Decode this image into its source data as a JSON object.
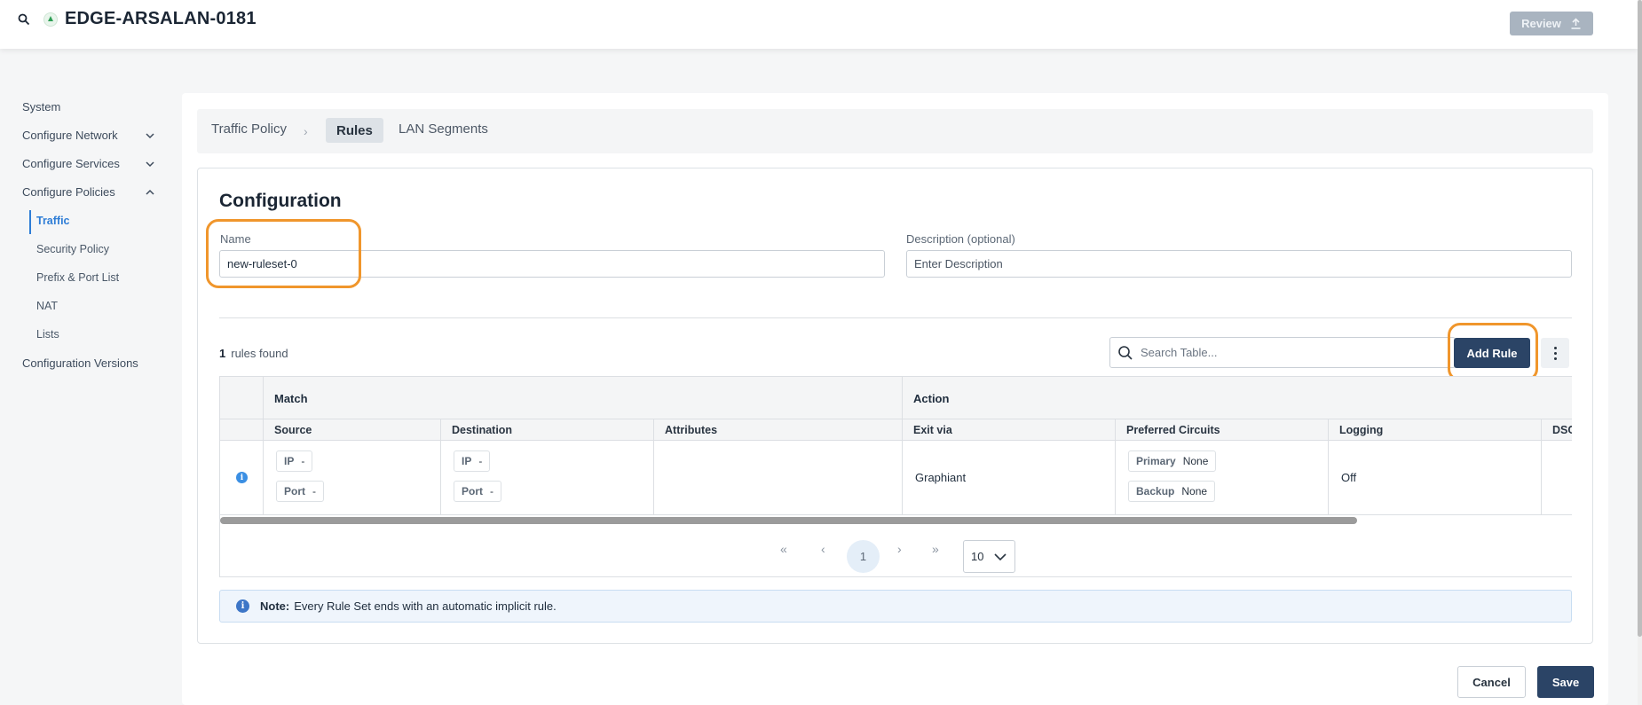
{
  "header": {
    "title": "EDGE-ARSALAN-0181",
    "review_label": "Review"
  },
  "sidebar": {
    "items": [
      {
        "label": "System"
      },
      {
        "label": "Configure Network"
      },
      {
        "label": "Configure Services"
      },
      {
        "label": "Configure Policies"
      },
      {
        "label": "Configuration Versions"
      }
    ],
    "sub_items": [
      {
        "label": "Traffic",
        "active": true
      },
      {
        "label": "Security Policy"
      },
      {
        "label": "Prefix & Port List"
      },
      {
        "label": "NAT"
      },
      {
        "label": "Lists"
      }
    ]
  },
  "breadcrumb": {
    "root": "Traffic Policy",
    "active": "Rules",
    "next": "LAN Segments"
  },
  "config": {
    "title": "Configuration",
    "name_label": "Name",
    "name_value": "new-ruleset-0",
    "desc_label": "Description (optional)",
    "desc_placeholder": "Enter Description"
  },
  "rules": {
    "count": "1",
    "count_suffix": "rules found",
    "search_placeholder": "Search Table...",
    "add_label": "Add Rule"
  },
  "table": {
    "groups": [
      "Match",
      "Action"
    ],
    "columns": [
      "Source",
      "Destination",
      "Attributes",
      "Exit via",
      "Preferred Circuits",
      "Logging",
      "DSC"
    ],
    "row": {
      "source_ip": "IP",
      "source_ip_val": "-",
      "source_port": "Port",
      "source_port_val": "-",
      "dest_ip": "IP",
      "dest_ip_val": "-",
      "dest_port": "Port",
      "dest_port_val": "-",
      "exit_via": "Graphiant",
      "primary_label": "Primary",
      "primary_val": "None",
      "backup_label": "Backup",
      "backup_val": "None",
      "logging": "Off"
    }
  },
  "pager": {
    "first": "«",
    "prev": "‹",
    "current": "1",
    "next": "›",
    "last": "»",
    "page_size": "10"
  },
  "note": {
    "label": "Note:",
    "text": "Every Rule Set ends with an automatic implicit rule."
  },
  "footer": {
    "cancel": "Cancel",
    "save": "Save"
  },
  "colors": {
    "accent": "#2b4466",
    "highlight": "#f0962c",
    "link": "#2e7dd6"
  }
}
